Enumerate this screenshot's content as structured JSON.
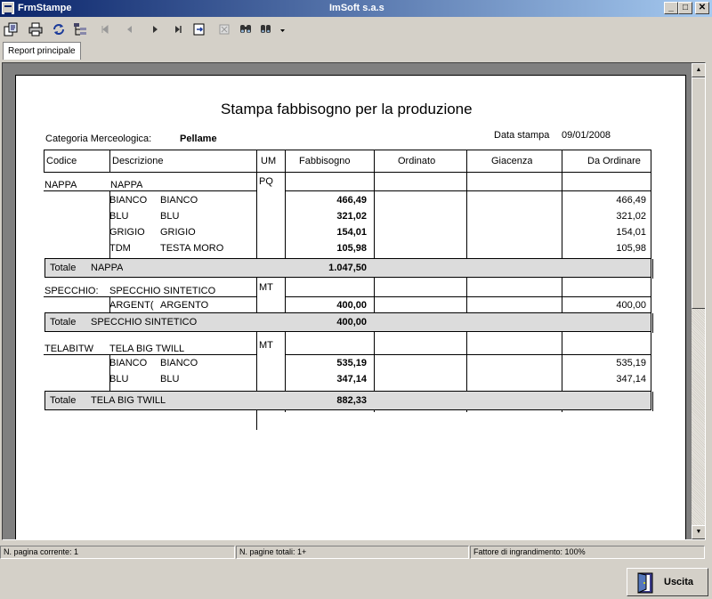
{
  "window": {
    "title": "FrmStampe",
    "center_title": "ImSoft s.a.s"
  },
  "tabs": [
    "Report principale"
  ],
  "report": {
    "title": "Stampa fabbisogno per la produzione",
    "category_label": "Categoria Merceologica:",
    "category_value": "Pellame",
    "date_label": "Data stampa",
    "date_value": "09/01/2008",
    "headers": [
      "Codice",
      "Descrizione",
      "UM",
      "Fabbisogno",
      "Ordinato",
      "Giacenza",
      "Da Ordinare"
    ],
    "groups": [
      {
        "code": "NAPPA",
        "desc": "NAPPA",
        "um": "PQ",
        "items": [
          {
            "code": "BIANCO",
            "desc": "BIANCO",
            "fabb": "466,49",
            "da": "466,49"
          },
          {
            "code": "BLU",
            "desc": "BLU",
            "fabb": "321,02",
            "da": "321,02"
          },
          {
            "code": "GRIGIO",
            "desc": "GRIGIO",
            "fabb": "154,01",
            "da": "154,01"
          },
          {
            "code": "TDM",
            "desc": "TESTA MORO",
            "fabb": "105,98",
            "da": "105,98"
          }
        ],
        "total_label": "Totale",
        "total_name": "NAPPA",
        "total": "1.047,50"
      },
      {
        "code": "SPECCHIO:",
        "desc": "SPECCHIO SINTETICO",
        "um": "MT",
        "items": [
          {
            "code": "ARGENT(",
            "desc": "ARGENTO",
            "fabb": "400,00",
            "da": "400,00"
          }
        ],
        "total_label": "Totale",
        "total_name": "SPECCHIO SINTETICO",
        "total": "400,00"
      },
      {
        "code": "TELABITW",
        "desc": "TELA BIG TWILL",
        "um": "MT",
        "items": [
          {
            "code": "BIANCO",
            "desc": "BIANCO",
            "fabb": "535,19",
            "da": "535,19"
          },
          {
            "code": "BLU",
            "desc": "BLU",
            "fabb": "347,14",
            "da": "347,14"
          }
        ],
        "total_label": "Totale",
        "total_name": "TELA BIG TWILL",
        "total": "882,33"
      }
    ]
  },
  "status": {
    "current_page": "N. pagina corrente: 1",
    "total_pages": "N. pagine totali: 1+",
    "zoom": "Fattore di ingrandimento: 100%"
  },
  "buttons": {
    "exit": "Uscita"
  },
  "toolbar_icons": [
    "export-icon",
    "print-icon",
    "refresh-icon",
    "tree-icon",
    "first-page-icon",
    "previous-page-icon",
    "next-page-icon",
    "last-page-icon",
    "goto-page-icon",
    "stop-icon",
    "search-icon",
    "zoom-icon"
  ]
}
